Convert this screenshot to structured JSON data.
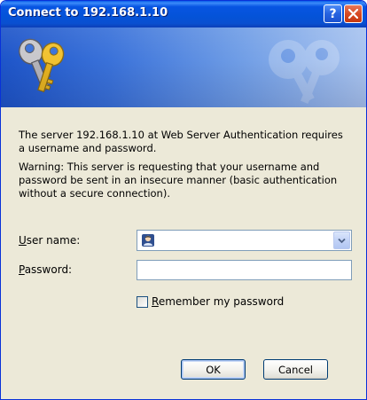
{
  "window": {
    "title": "Connect to 192.168.1.10"
  },
  "titlebar": {
    "help_glyph": "?",
    "help_icon": "help-icon",
    "close_icon": "close-icon"
  },
  "banner": {
    "icon": "keys-icon",
    "watermark_icon": "keys-watermark-icon"
  },
  "messages": {
    "line1": "The server 192.168.1.10 at Web Server Authentication requires a username and password.",
    "line2": "Warning: This server is requesting that your username and password be sent in an insecure manner (basic authentication without a secure connection)."
  },
  "form": {
    "username": {
      "label_first": "U",
      "label_rest": "ser name:",
      "value": "",
      "icon": "user-icon"
    },
    "password": {
      "label_first": "P",
      "label_rest": "assword:",
      "value": ""
    },
    "remember": {
      "label_first": "R",
      "label_rest": "emember my password",
      "checked": false
    }
  },
  "buttons": {
    "ok": "OK",
    "cancel": "Cancel"
  },
  "colors": {
    "titlebar": "#0454d8",
    "dialog_bg": "#ece9d8",
    "close_button": "#d84a23",
    "field_border": "#7f9db9"
  }
}
